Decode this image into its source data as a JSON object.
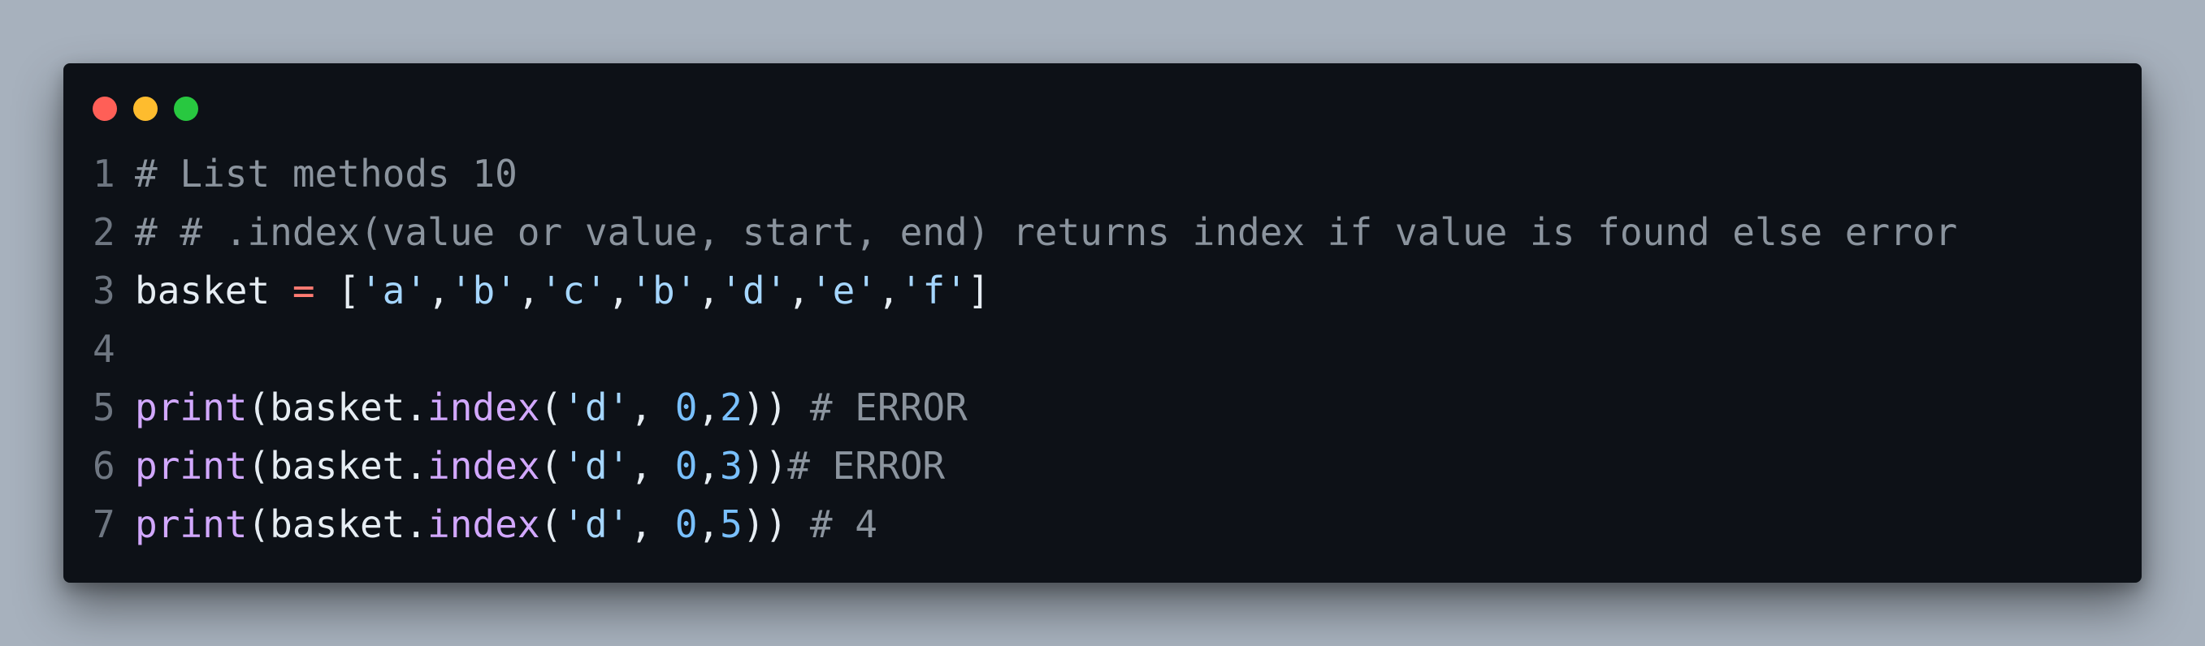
{
  "window": {
    "dots": [
      {
        "name": "close",
        "color": "#ff5f57"
      },
      {
        "name": "minimize",
        "color": "#febc2e"
      },
      {
        "name": "maximize",
        "color": "#28c840"
      }
    ]
  },
  "code": {
    "lines": [
      {
        "number": "1",
        "tokens": [
          {
            "type": "comment",
            "text": "# List methods 10"
          }
        ]
      },
      {
        "number": "2",
        "tokens": [
          {
            "type": "comment",
            "text": "# # .index(value or value, start, end) returns index if value is found else error"
          }
        ]
      },
      {
        "number": "3",
        "tokens": [
          {
            "type": "plain",
            "text": "basket "
          },
          {
            "type": "op",
            "text": "="
          },
          {
            "type": "plain",
            "text": " ["
          },
          {
            "type": "str",
            "text": "'a'"
          },
          {
            "type": "plain",
            "text": ","
          },
          {
            "type": "str",
            "text": "'b'"
          },
          {
            "type": "plain",
            "text": ","
          },
          {
            "type": "str",
            "text": "'c'"
          },
          {
            "type": "plain",
            "text": ","
          },
          {
            "type": "str",
            "text": "'b'"
          },
          {
            "type": "plain",
            "text": ","
          },
          {
            "type": "str",
            "text": "'d'"
          },
          {
            "type": "plain",
            "text": ","
          },
          {
            "type": "str",
            "text": "'e'"
          },
          {
            "type": "plain",
            "text": ","
          },
          {
            "type": "str",
            "text": "'f'"
          },
          {
            "type": "plain",
            "text": "]"
          }
        ]
      },
      {
        "number": "4",
        "tokens": []
      },
      {
        "number": "5",
        "tokens": [
          {
            "type": "fn",
            "text": "print"
          },
          {
            "type": "plain",
            "text": "(basket."
          },
          {
            "type": "fn",
            "text": "index"
          },
          {
            "type": "plain",
            "text": "("
          },
          {
            "type": "str",
            "text": "'d'"
          },
          {
            "type": "plain",
            "text": ", "
          },
          {
            "type": "num",
            "text": "0"
          },
          {
            "type": "plain",
            "text": ","
          },
          {
            "type": "num",
            "text": "2"
          },
          {
            "type": "plain",
            "text": ")) "
          },
          {
            "type": "comment",
            "text": "# ERROR"
          }
        ]
      },
      {
        "number": "6",
        "tokens": [
          {
            "type": "fn",
            "text": "print"
          },
          {
            "type": "plain",
            "text": "(basket."
          },
          {
            "type": "fn",
            "text": "index"
          },
          {
            "type": "plain",
            "text": "("
          },
          {
            "type": "str",
            "text": "'d'"
          },
          {
            "type": "plain",
            "text": ", "
          },
          {
            "type": "num",
            "text": "0"
          },
          {
            "type": "plain",
            "text": ","
          },
          {
            "type": "num",
            "text": "3"
          },
          {
            "type": "plain",
            "text": "))"
          },
          {
            "type": "comment",
            "text": "# ERROR"
          }
        ]
      },
      {
        "number": "7",
        "tokens": [
          {
            "type": "fn",
            "text": "print"
          },
          {
            "type": "plain",
            "text": "(basket."
          },
          {
            "type": "fn",
            "text": "index"
          },
          {
            "type": "plain",
            "text": "("
          },
          {
            "type": "str",
            "text": "'d'"
          },
          {
            "type": "plain",
            "text": ", "
          },
          {
            "type": "num",
            "text": "0"
          },
          {
            "type": "plain",
            "text": ","
          },
          {
            "type": "num",
            "text": "5"
          },
          {
            "type": "plain",
            "text": ")) "
          },
          {
            "type": "comment",
            "text": "# 4"
          }
        ]
      }
    ]
  }
}
